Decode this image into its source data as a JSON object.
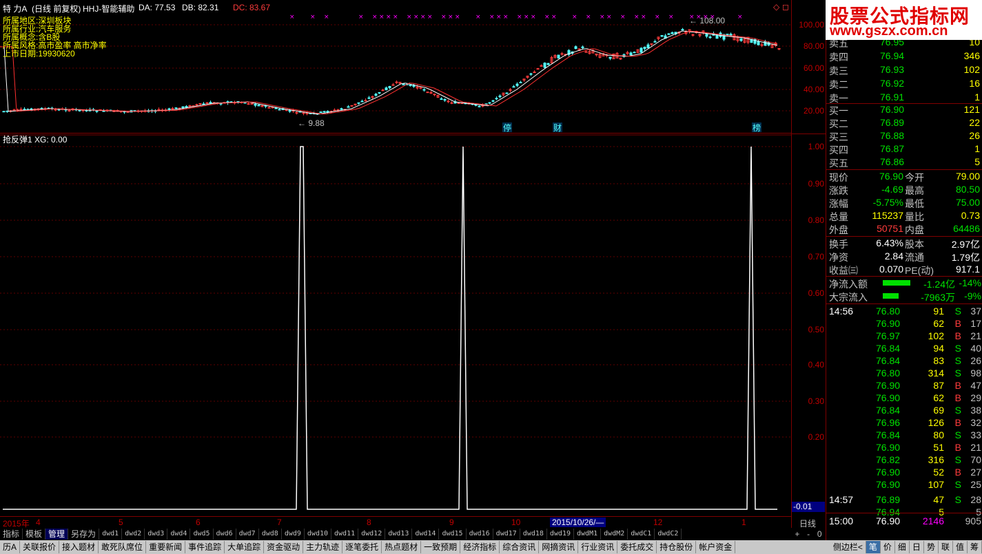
{
  "title": {
    "stock": "特 力A",
    "mode": "(日线 前复权)",
    "indicator": "HHJ-智能辅助",
    "da": "DA: 77.53",
    "db": "DB: 82.31",
    "dc": "DC: 83.67"
  },
  "info": [
    {
      "label": "所属地区:",
      "value": "深圳板块"
    },
    {
      "label": "所属行业:",
      "value": "汽车服务"
    },
    {
      "label": "所属概念:",
      "value": "含B股"
    },
    {
      "label": "所属风格:",
      "value": "高市盈率 高市净率"
    },
    {
      "label": "上市日期:",
      "value": "19930620"
    }
  ],
  "main_chart": {
    "price_axis": [
      "100.00",
      "80.00",
      "60.00",
      "40.00",
      "20.00"
    ],
    "high_marker": "108.00",
    "low_marker": "9.88",
    "event_tags": [
      "停",
      "财",
      "榜"
    ],
    "colors": {
      "up": "#ff3c3c",
      "down": "#54ffff",
      "ma1": "#ffffff",
      "ma2": "#ff3030",
      "ma3": "#ffff00"
    }
  },
  "indicator_panel": {
    "title": "抢反弹1 XG: 0.00",
    "axis": [
      "1.00",
      "0.90",
      "0.80",
      "0.70",
      "0.60",
      "0.50",
      "0.40",
      "0.30",
      "0.20"
    ],
    "low_value": "-0.01",
    "period": "日线"
  },
  "dates": [
    "2015年",
    "4",
    "5",
    "6",
    "7",
    "8",
    "9",
    "10",
    "2015/10/26/—",
    "12",
    "1"
  ],
  "tabs": [
    "指标",
    "模板",
    "管理",
    "另存为",
    "dwd1",
    "dwd2",
    "dwd3",
    "dwd4",
    "dwd5",
    "dwd6",
    "dwd7",
    "dwd8",
    "dwd9",
    "dwd10",
    "dwd11",
    "dwd12",
    "dwd13",
    "dwd14",
    "dwd15",
    "dwd16",
    "dwd17",
    "dwd18",
    "dwd19",
    "dwdM1",
    "dwdM2",
    "dwdC1",
    "dwdC2"
  ],
  "side_controls": [
    "+",
    "-",
    "0"
  ],
  "bottom_nav": [
    "历A",
    "关联报价",
    "接入题材",
    "敢死队席位",
    "重要新闻",
    "事件追踪",
    "大单追踪",
    "资金驱动",
    "主力轨迹",
    "逐笔委托",
    "热点题材",
    "一致预期",
    "经济指标",
    "综合资讯",
    "网摘资讯",
    "行业资讯",
    "委托成交",
    "持仓股份",
    "帐户资金"
  ],
  "bottom_nav_right": [
    "侧边栏<",
    "笔",
    "价",
    "细",
    "日",
    "势",
    "联",
    "值",
    "筹"
  ],
  "logo": {
    "line1": "股票公式指标网",
    "line2": "www.gszx.com.cn"
  },
  "quotes": {
    "asks": [
      {
        "label": "卖五",
        "price": "76.95",
        "vol": "10"
      },
      {
        "label": "卖四",
        "price": "76.94",
        "vol": "346"
      },
      {
        "label": "卖三",
        "price": "76.93",
        "vol": "102"
      },
      {
        "label": "卖二",
        "price": "76.92",
        "vol": "16"
      },
      {
        "label": "卖一",
        "price": "76.91",
        "vol": "1"
      }
    ],
    "bids": [
      {
        "label": "买一",
        "price": "76.90",
        "vol": "121"
      },
      {
        "label": "买二",
        "price": "76.89",
        "vol": "22"
      },
      {
        "label": "买三",
        "price": "76.88",
        "vol": "26"
      },
      {
        "label": "买四",
        "price": "76.87",
        "vol": "1"
      },
      {
        "label": "买五",
        "price": "76.86",
        "vol": "5"
      }
    ]
  },
  "stats": [
    {
      "l1": "现价",
      "v1": "76.90",
      "l2": "今开",
      "v2": "79.00"
    },
    {
      "l1": "涨跌",
      "v1": "-4.69",
      "l2": "最高",
      "v2": "80.50"
    },
    {
      "l1": "涨幅",
      "v1": "-5.75%",
      "l2": "最低",
      "v2": "75.00"
    },
    {
      "l1": "总量",
      "v1": "115237",
      "l2": "量比",
      "v2": "0.73"
    },
    {
      "l1": "外盘",
      "v1": "50751",
      "l2": "内盘",
      "v2": "64486"
    }
  ],
  "fundamentals": [
    {
      "l1": "换手",
      "v1": "6.43%",
      "l2": "股本",
      "v2": "2.97亿"
    },
    {
      "l1": "净资",
      "v1": "2.84",
      "l2": "流通",
      "v2": "1.79亿"
    },
    {
      "l1": "收益㈢",
      "v1": "0.070",
      "l2": "PE(动)",
      "v2": "917.1"
    }
  ],
  "flows": [
    {
      "label": "净流入额",
      "value": "-1.24亿",
      "pct": "-14%",
      "bar": 0.8
    },
    {
      "label": "大宗流入",
      "value": "-7963万",
      "pct": "-9%",
      "bar": 0.45
    }
  ],
  "ticks": [
    {
      "time": "14:56",
      "price": "76.80",
      "vol": "91",
      "side": "S",
      "n": "37"
    },
    {
      "time": "",
      "price": "76.90",
      "vol": "62",
      "side": "B",
      "n": "17"
    },
    {
      "time": "",
      "price": "76.97",
      "vol": "102",
      "side": "B",
      "n": "21"
    },
    {
      "time": "",
      "price": "76.84",
      "vol": "94",
      "side": "S",
      "n": "40"
    },
    {
      "time": "",
      "price": "76.84",
      "vol": "83",
      "side": "S",
      "n": "26"
    },
    {
      "time": "",
      "price": "76.80",
      "vol": "314",
      "side": "S",
      "n": "98"
    },
    {
      "time": "",
      "price": "76.90",
      "vol": "87",
      "side": "B",
      "n": "47"
    },
    {
      "time": "",
      "price": "76.90",
      "vol": "62",
      "side": "B",
      "n": "29"
    },
    {
      "time": "",
      "price": "76.84",
      "vol": "69",
      "side": "S",
      "n": "38"
    },
    {
      "time": "",
      "price": "76.96",
      "vol": "126",
      "side": "B",
      "n": "32"
    },
    {
      "time": "",
      "price": "76.84",
      "vol": "80",
      "side": "S",
      "n": "33"
    },
    {
      "time": "",
      "price": "76.90",
      "vol": "51",
      "side": "B",
      "n": "21"
    },
    {
      "time": "",
      "price": "76.82",
      "vol": "316",
      "side": "S",
      "n": "70"
    },
    {
      "time": "",
      "price": "76.90",
      "vol": "52",
      "side": "B",
      "n": "27"
    },
    {
      "time": "",
      "price": "76.90",
      "vol": "107",
      "side": "S",
      "n": "25"
    },
    {
      "time": "14:57",
      "price": "76.89",
      "vol": "47",
      "side": "S",
      "n": "28"
    },
    {
      "time": "",
      "price": "76.94",
      "vol": "5",
      "side": "",
      "n": "5"
    },
    {
      "time": "15:00",
      "price": "76.90",
      "vol": "2146",
      "side": "",
      "n": "905"
    }
  ]
}
